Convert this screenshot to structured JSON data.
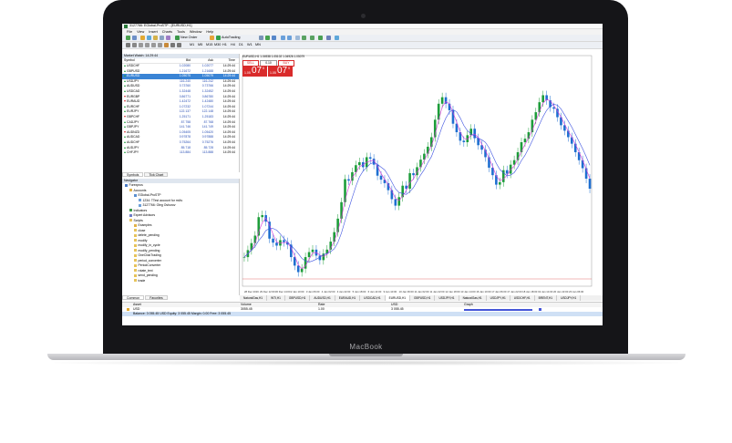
{
  "device": {
    "brand": "MacBook"
  },
  "window": {
    "title": "3127766: EGlobal-ProSTP - [EURUSD,H1]"
  },
  "menu": [
    "File",
    "View",
    "Insert",
    "Charts",
    "Tools",
    "Window",
    "Help"
  ],
  "toolbar": {
    "new_order": "New Order",
    "autotrading": "AutoTrading",
    "timeframes": [
      "M1",
      "M5",
      "M15",
      "M30",
      "H1",
      "H4",
      "D1",
      "W1",
      "MN"
    ]
  },
  "market_watch": {
    "title": "Market Watch: 14:29:44",
    "headers": {
      "symbol": "Symbol",
      "bid": "Bid",
      "ask": "Ask",
      "time": "Time"
    },
    "rows": [
      {
        "symbol": "USDCHF",
        "bid": "1.02080",
        "ask": "1.02077",
        "time": "14:29:44",
        "dir": "up"
      },
      {
        "symbol": "GBPUSD",
        "bid": "1.21672",
        "ask": "1.21688",
        "time": "14:29:44",
        "dir": "up"
      },
      {
        "symbol": "EURUSD",
        "bid": "1.05075",
        "ask": "1.05079",
        "time": "14:29:44",
        "dir": "up",
        "selected": true
      },
      {
        "symbol": "USDJPY",
        "bid": "116.240",
        "ask": "116.242",
        "time": "14:29:44",
        "dir": "up"
      },
      {
        "symbol": "AUDUSD",
        "bid": "0.73760",
        "ask": "0.73766",
        "time": "14:29:44",
        "dir": "up"
      },
      {
        "symbol": "USDCAD",
        "bid": "1.32448",
        "ask": "1.32452",
        "time": "14:29:44",
        "dir": "up"
      },
      {
        "symbol": "EURGBP",
        "bid": "0.86771",
        "ask": "0.86780",
        "time": "14:29:44",
        "dir": "dn"
      },
      {
        "symbol": "EURAUD",
        "bid": "1.42472",
        "ask": "1.42480",
        "time": "14:29:44",
        "dir": "dn"
      },
      {
        "symbol": "EURCHF",
        "bid": "1.07232",
        "ask": "1.07244",
        "time": "14:29:44",
        "dir": "up"
      },
      {
        "symbol": "EURJPY",
        "bid": "122.137",
        "ask": "122.148",
        "time": "14:29:44",
        "dir": "up"
      },
      {
        "symbol": "GBPCHF",
        "bid": "1.25171",
        "ask": "1.25183",
        "time": "14:29:44",
        "dir": "dn"
      },
      {
        "symbol": "CADJPY",
        "bid": "87.758",
        "ask": "87.768",
        "time": "14:29:44",
        "dir": "up"
      },
      {
        "symbol": "GBPJPY",
        "bid": "141.746",
        "ask": "141.749",
        "time": "14:29:44",
        "dir": "up"
      },
      {
        "symbol": "AUDNZD",
        "bid": "1.05405",
        "ask": "1.05420",
        "time": "14:29:44",
        "dir": "dn"
      },
      {
        "symbol": "AUDCAD",
        "bid": "0.97878",
        "ask": "0.97888",
        "time": "14:29:44",
        "dir": "up"
      },
      {
        "symbol": "AUDCHF",
        "bid": "0.75264",
        "ask": "0.75276",
        "time": "14:29:44",
        "dir": "up"
      },
      {
        "symbol": "AUDJPY",
        "bid": "85.718",
        "ask": "85.728",
        "time": "14:29:44",
        "dir": "up"
      },
      {
        "symbol": "CHFJPY",
        "bid": "113.884",
        "ask": "113.888",
        "time": "14:29:44",
        "dir": "up"
      }
    ],
    "tabs": [
      "Symbols",
      "Tick Chart"
    ]
  },
  "navigator": {
    "title": "Navigator",
    "items": [
      {
        "label": "Forexpros",
        "depth": 0,
        "icon": "terminal-icon"
      },
      {
        "label": "Accounts",
        "depth": 1,
        "icon": "folder-icon"
      },
      {
        "label": "EGlobal-ProSTP",
        "depth": 2,
        "icon": "account-icon"
      },
      {
        "label": "1234: TTest account for mt4v",
        "depth": 3,
        "icon": "user-icon"
      },
      {
        "label": "3127766: Oleg Oshurov",
        "depth": 3,
        "icon": "user-icon"
      },
      {
        "label": "Indicators",
        "depth": 1,
        "icon": "indicator-icon"
      },
      {
        "label": "Expert Advisors",
        "depth": 1,
        "icon": "expert-icon"
      },
      {
        "label": "Scripts",
        "depth": 1,
        "icon": "script-icon"
      },
      {
        "label": "Examples",
        "depth": 2,
        "icon": "folder-icon"
      },
      {
        "label": "close",
        "depth": 2,
        "icon": "script-icon"
      },
      {
        "label": "delete_pending",
        "depth": 2,
        "icon": "script-icon"
      },
      {
        "label": "modify",
        "depth": 2,
        "icon": "script-icon"
      },
      {
        "label": "modify_in_cycle",
        "depth": 2,
        "icon": "script-icon"
      },
      {
        "label": "modify_pending",
        "depth": 2,
        "icon": "script-icon"
      },
      {
        "label": "OneClickTrading",
        "depth": 2,
        "icon": "script-icon"
      },
      {
        "label": "period_converter",
        "depth": 2,
        "icon": "script-icon"
      },
      {
        "label": "PeriodConverter",
        "depth": 2,
        "icon": "script-icon"
      },
      {
        "label": "rotate_text",
        "depth": 2,
        "icon": "script-icon"
      },
      {
        "label": "send_pending",
        "depth": 2,
        "icon": "script-icon"
      },
      {
        "label": "trade",
        "depth": 2,
        "icon": "script-icon"
      }
    ],
    "tabs": [
      "Common",
      "Favorites"
    ]
  },
  "chart": {
    "info": "EURUSD,H1 1.04938 1.05102 1.04926 1.05079",
    "one_click": {
      "sell_label": "SELL",
      "buy_label": "BUY",
      "lots": "0.10",
      "sell_price": "1.05",
      "sell_big": "07",
      "sell_sup": "5",
      "buy_price": "1.05",
      "buy_big": "07",
      "buy_sup": "9"
    },
    "x_labels": [
      "28 Dec 2016",
      "29 Dec 12:00",
      "30 Dec 14:00",
      "2 Jan 10:00",
      "3 Jan 06:00",
      "4 Jan 02:00",
      "4 Jan 22:00",
      "5 Jan 18:00",
      "6 Jan 14:00",
      "9 Jan 10:00",
      "10 Jan 06:00",
      "11 Jan 02:00",
      "11 Jan 22:00",
      "12 Jan 18:00",
      "13 Jan 14:00",
      "16 Jan 10:00",
      "17 Jan 06:00",
      "17 Jan 22:00",
      "18 Jan 18:00",
      "19 Jan 14:00",
      "20 Jan 10:00",
      "23 Jan 06:00"
    ],
    "tabs": [
      "NaturalGas,H1",
      "WTI,H1",
      "GBPUSD,H1",
      "AUDUSD,H1",
      "EURAUD,H1",
      "USDCAD,H1",
      "EURUSD,H1",
      "GBPUSD,H1",
      "USDJPY,H1",
      "NaturalGas,H1",
      "USDJPY,H1",
      "USDCHF,H1",
      "BRENT,H1",
      "USDJPY,H1"
    ],
    "active_tab": 6
  },
  "chart_data": {
    "type": "candlestick",
    "symbol": "EURUSD",
    "timeframe": "H1",
    "closes": [
      1.0418,
      1.0432,
      1.0446,
      1.0461,
      1.0498,
      1.0502,
      1.0489,
      1.0455,
      1.0447,
      1.0441,
      1.0452,
      1.0448,
      1.0443,
      1.0418,
      1.0401,
      1.0388,
      1.0395,
      1.0418,
      1.0428,
      1.0433,
      1.0421,
      1.0412,
      1.0425,
      1.0433,
      1.0449,
      1.0468,
      1.0495,
      1.0528,
      1.0574,
      1.0571,
      1.0588,
      1.0602,
      1.0608,
      1.0598,
      1.0618,
      1.0615,
      1.0603,
      1.0581,
      1.0573,
      1.0566,
      1.0552,
      1.0534,
      1.0521,
      1.0538,
      1.0561,
      1.0555,
      1.0586,
      1.0582,
      1.0598,
      1.0613,
      1.0625,
      1.0639,
      1.0658,
      1.0693,
      1.0725,
      1.0738,
      1.0725,
      1.0712,
      1.0685,
      1.0668,
      1.0651,
      1.0648,
      1.0662,
      1.0675,
      1.0656,
      1.0642,
      1.0633,
      1.0618,
      1.0597,
      1.0582,
      1.0563,
      1.0568,
      1.0592,
      1.0585,
      1.0603,
      1.0612,
      1.0628,
      1.0648,
      1.0655,
      1.0668,
      1.0693,
      1.0708,
      1.0728,
      1.0742,
      1.0732,
      1.0718,
      1.0715,
      1.0698,
      1.0682,
      1.0671,
      1.0658,
      1.0645,
      1.0628,
      1.0612,
      1.0596,
      1.0575,
      1.0555
    ]
  },
  "terminal": {
    "headers": {
      "asset": "Asset",
      "volume": "Volume",
      "rate": "Rate",
      "usd": "USD",
      "graph": "Graph"
    },
    "row": {
      "asset": "USD",
      "volume": "3055.45",
      "rate": "1.00",
      "usd": "3 055.45"
    },
    "balance": "Balance: 3 055.45 USD  Equity: 3 055.45  Margin: 0.00  Free: 3 055.45"
  },
  "colors": {
    "bull": "#1d9d3a",
    "bear": "#1e6fd0",
    "ma_fast": "#d733d7",
    "ma_slow": "#3d52e0",
    "sell": "#d92b2b",
    "buy": "#d92b2b"
  }
}
